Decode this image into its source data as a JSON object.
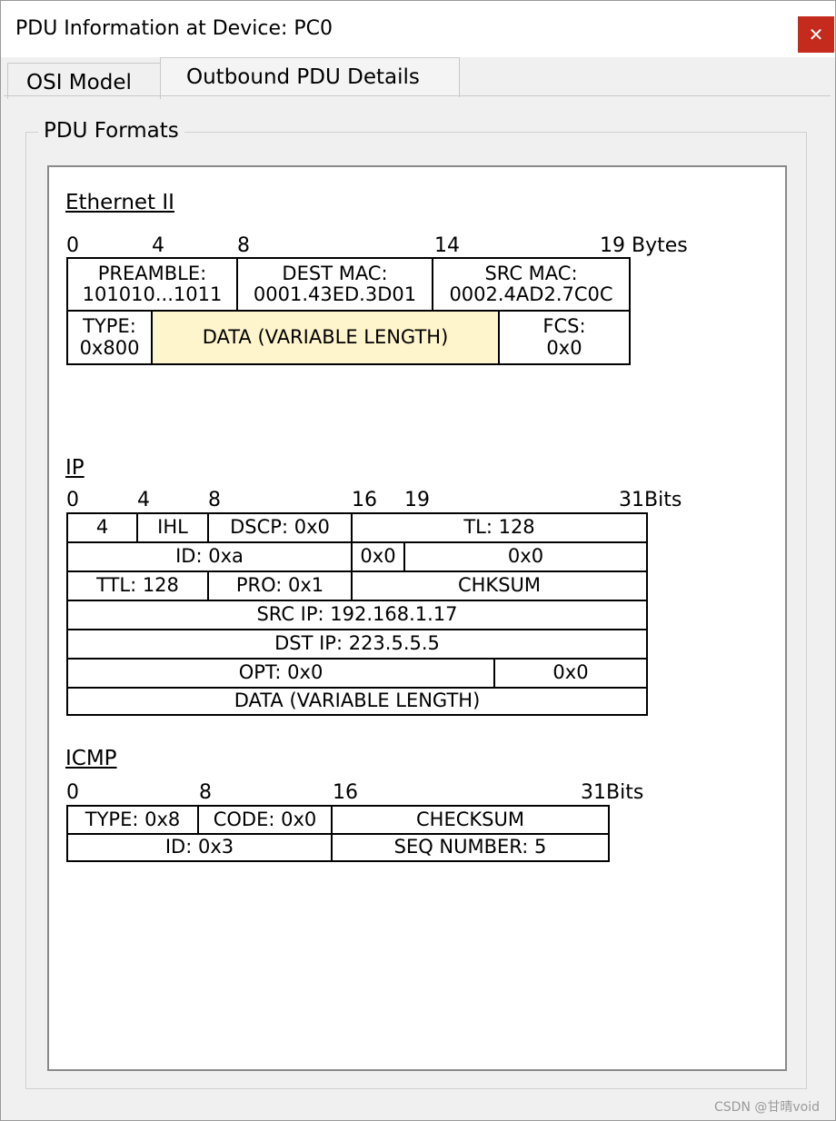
{
  "window": {
    "title": "PDU Information at Device: PC0",
    "close_glyph": "✕"
  },
  "tabs": [
    {
      "label": "OSI Model"
    },
    {
      "label": "Outbound PDU Details"
    }
  ],
  "group": {
    "label": "PDU Formats"
  },
  "ethernet": {
    "title": "Ethernet II",
    "ruler": [
      "0",
      "4",
      "8",
      "14",
      "19",
      "Bytes"
    ],
    "preamble": {
      "name": "PREAMBLE:",
      "value": "101010...1011"
    },
    "dest_mac": {
      "name": "DEST MAC:",
      "value": "0001.43ED.3D01"
    },
    "src_mac": {
      "name": "SRC MAC:",
      "value": "0002.4AD2.7C0C"
    },
    "type": {
      "name": "TYPE:",
      "value": "0x800"
    },
    "data": "DATA (VARIABLE LENGTH)",
    "fcs": {
      "name": "FCS:",
      "value": "0x0"
    }
  },
  "ip": {
    "title": "IP",
    "ruler": [
      "0",
      "4",
      "8",
      "16",
      "19",
      "31Bits"
    ],
    "version": "4",
    "ihl": "IHL",
    "dscp": "DSCP: 0x0",
    "tl": "TL: 128",
    "id": "ID: 0xa",
    "flags": "0x0",
    "frag": "0x0",
    "ttl": "TTL: 128",
    "pro": "PRO: 0x1",
    "chksum": "CHKSUM",
    "src_ip": "SRC IP: 192.168.1.17",
    "dst_ip": "DST IP: 223.5.5.5",
    "opt": "OPT: 0x0",
    "pad": "0x0",
    "data": "DATA (VARIABLE LENGTH)"
  },
  "icmp": {
    "title": "ICMP",
    "ruler": [
      "0",
      "8",
      "16",
      "31Bits"
    ],
    "type": "TYPE: 0x8",
    "code": "CODE: 0x0",
    "checksum": "CHECKSUM",
    "id": "ID: 0x3",
    "seq": "SEQ NUMBER: 5"
  },
  "watermark": "CSDN @甘晴void"
}
